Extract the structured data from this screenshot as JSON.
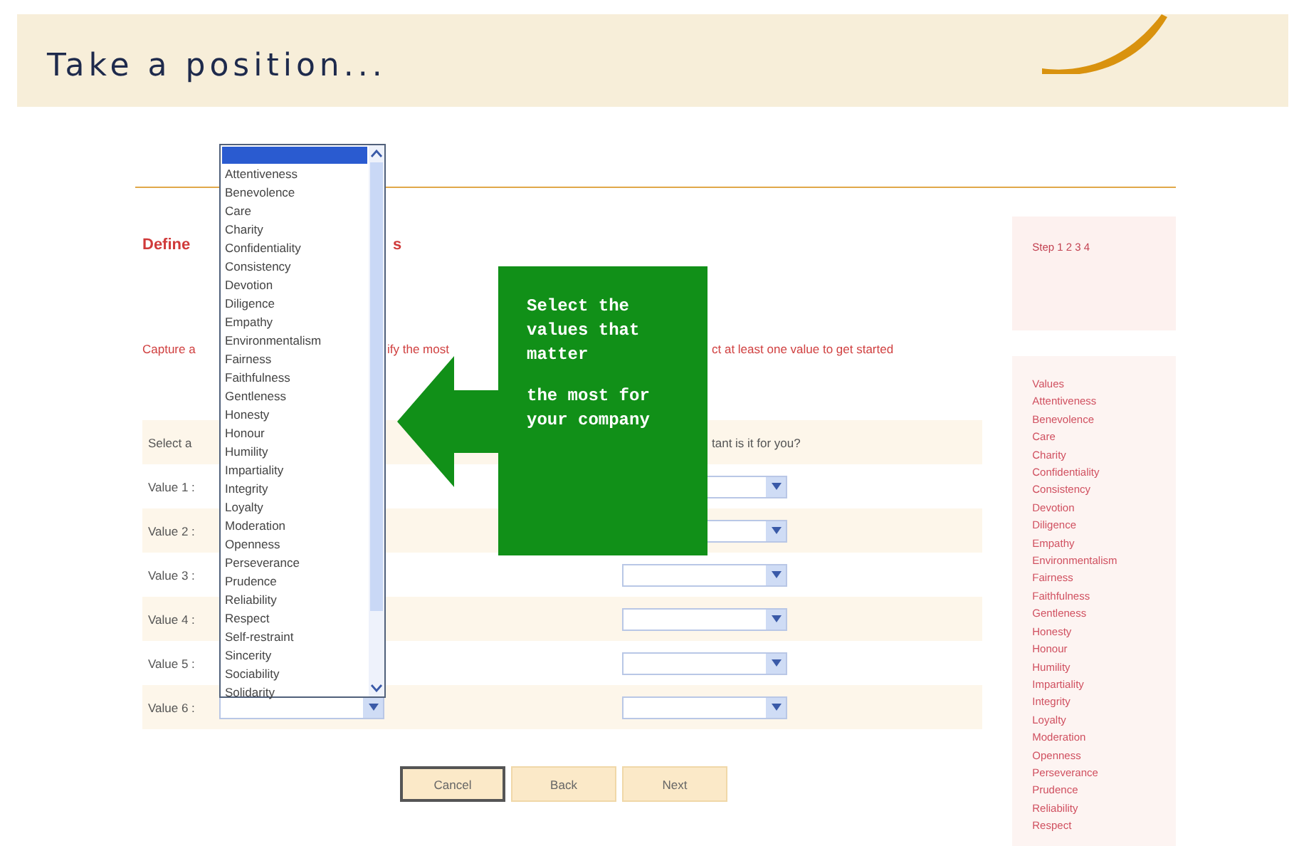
{
  "header": {
    "title": "Take a position..."
  },
  "form": {
    "heading_parts": [
      "Define",
      "s"
    ],
    "intro_parts": [
      "Capture a",
      "ify the most",
      "ct at least one value to get started"
    ],
    "question_parts": [
      "Select a",
      "tant is it for you?"
    ],
    "rows": [
      {
        "label": "Value 1 :",
        "first_visible": false
      },
      {
        "label": "Value 2 :",
        "first_visible": false
      },
      {
        "label": "Value 3 :",
        "first_visible": false
      },
      {
        "label": "Value 4 :",
        "first_visible": false
      },
      {
        "label": "Value 5 :",
        "first_visible": false
      },
      {
        "label": "Value 6 :",
        "first_visible": true
      }
    ],
    "open_list": {
      "blank_selected": true,
      "items": [
        "Attentiveness",
        "Benevolence",
        "Care",
        "Charity",
        "Confidentiality",
        "Consistency",
        "Devotion",
        "Diligence",
        "Empathy",
        "Environmentalism",
        "Fairness",
        "Faithfulness",
        "Gentleness",
        "Honesty",
        "Honour",
        "Humility",
        "Impartiality",
        "Integrity",
        "Loyalty",
        "Moderation",
        "Openness",
        "Perseverance",
        "Prudence",
        "Reliability",
        "Respect",
        "Self-restraint",
        "Sincerity",
        "Sociability",
        "Solidarity"
      ]
    },
    "buttons": [
      {
        "label": "Cancel",
        "focused": true
      },
      {
        "label": "Back",
        "focused": false
      },
      {
        "label": "Next",
        "focused": false
      }
    ]
  },
  "callout": {
    "lines": [
      "Select the values that matter",
      "the most for your company"
    ]
  },
  "sidebar": {
    "steps": "Step 1 2 3 4",
    "values_title": "Values",
    "values": [
      "Attentiveness",
      "Benevolence",
      "Care",
      "Charity",
      "Confidentiality",
      "Consistency",
      "Devotion",
      "Diligence",
      "Empathy",
      "Environmentalism",
      "Fairness",
      "Faithfulness",
      "Gentleness",
      "Honesty",
      "Honour",
      "Humility",
      "Impartiality",
      "Integrity",
      "Loyalty",
      "Moderation",
      "Openness",
      "Perseverance",
      "Prudence",
      "Reliability",
      "Respect"
    ]
  }
}
